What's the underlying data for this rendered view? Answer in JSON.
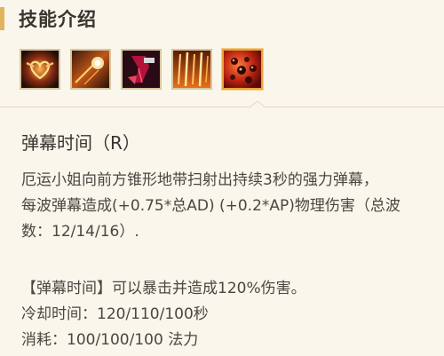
{
  "header": {
    "title": "技能介绍"
  },
  "skills": {
    "icons": [
      {
        "name": "passive-heart-icon",
        "selected": false
      },
      {
        "name": "double-up-icon",
        "selected": false
      },
      {
        "name": "strut-icon",
        "selected": false
      },
      {
        "name": "make-it-rain-icon",
        "selected": false
      },
      {
        "name": "bullet-time-icon",
        "selected": true
      }
    ]
  },
  "detail": {
    "name": "弹幕时间（R）",
    "description_lines": [
      "厄运小姐向前方锥形地带扫射出持续3秒的强力弹幕，",
      "每波弹幕造成(+0.75*总AD) (+0.2*AP)物理伤害（总波",
      "数：12/14/16）."
    ],
    "effect": "【弹幕时间】可以暴击并造成120%伤害。",
    "cooldown": "冷却时间：120/110/100秒",
    "cost": "消耗：100/100/100 法力"
  },
  "colors": {
    "background": "#faf6ec",
    "accent": "#e0b45c",
    "selected_border": "#e7a33e",
    "text": "#3a3530"
  }
}
